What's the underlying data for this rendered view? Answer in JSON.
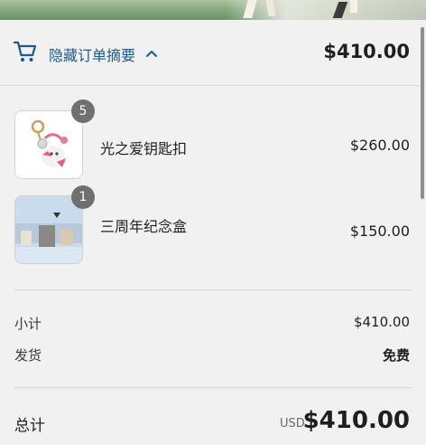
{
  "summary": {
    "toggle_label": "隐藏订单摘要",
    "total": "$410.00",
    "icons": {
      "cart": "cart-icon",
      "toggle": "chevron-up-icon"
    }
  },
  "items": [
    {
      "name": "光之爱钥匙扣",
      "price": "$260.00",
      "quantity": "5"
    },
    {
      "name": "三周年纪念盒",
      "price": "$150.00",
      "quantity": "1"
    }
  ],
  "costs": {
    "subtotal_label": "小计",
    "subtotal_value": "$410.00",
    "shipping_label": "发货",
    "shipping_value": "免费"
  },
  "total": {
    "label": "总计",
    "currency": "USD",
    "value": "$410.00"
  },
  "colors": {
    "accent": "#1d5a8a",
    "badge": "#707070",
    "background": "#f1f1f1"
  }
}
